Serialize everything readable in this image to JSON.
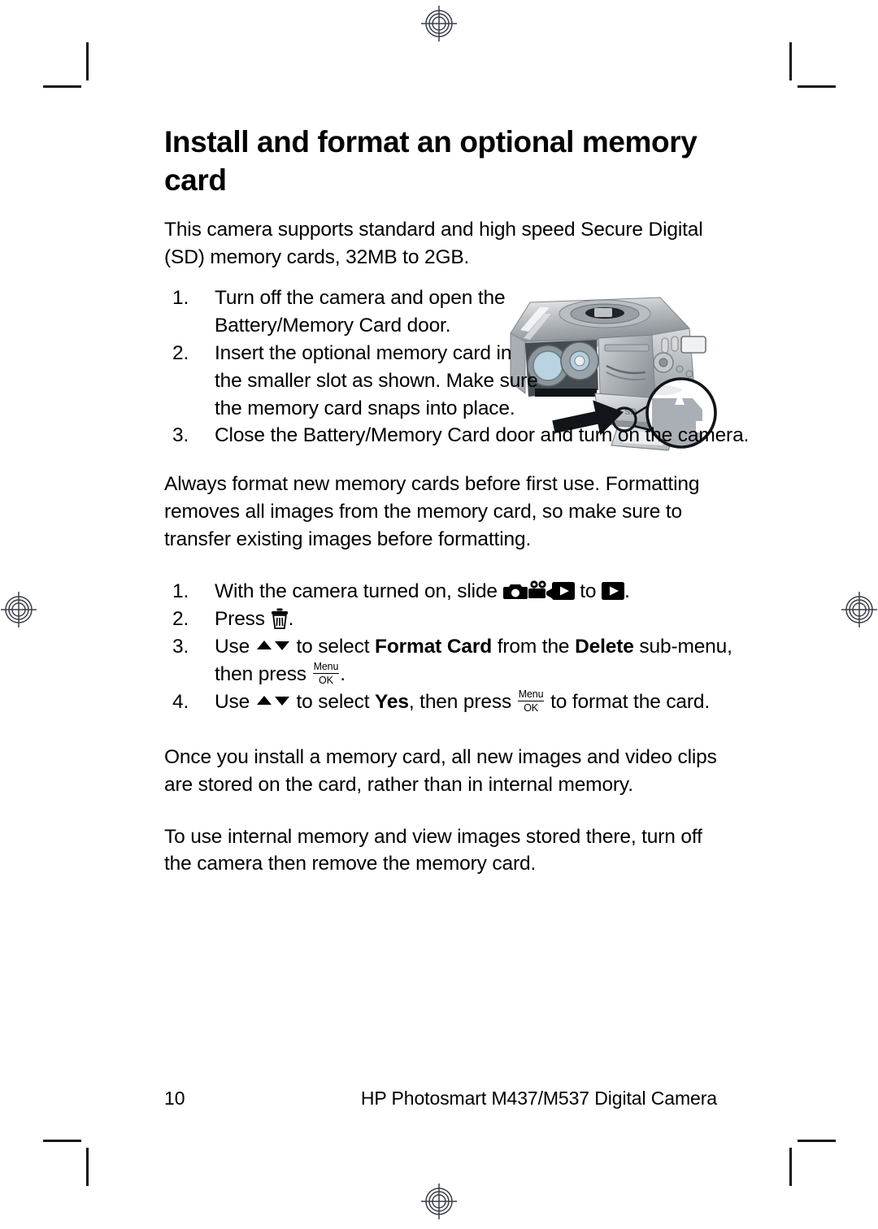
{
  "document": {
    "title": "Install and format an optional memory card",
    "intro": "This camera supports standard and high speed Secure Digital (SD) memory cards, 32MB to 2GB."
  },
  "install_steps": {
    "step1": {
      "num": "1.",
      "text": "Turn off the camera and open the Battery/Memory Card door."
    },
    "step2": {
      "num": "2.",
      "text": "Insert the optional memory card in the smaller slot as shown. Make sure the memory card snaps into place."
    },
    "step3": {
      "num": "3.",
      "text": "Close the Battery/Memory Card door and turn on the camera."
    }
  },
  "figure": {
    "name": "camera-memory-card-insertion-illustration",
    "caption": "Camera with Battery/Memory Card door open showing memory card being inserted into the smaller slot, with magnified detail of card orientation"
  },
  "format_note": "Always format new memory cards before first use. Formatting removes all images from the memory card, so make sure to transfer existing images before formatting.",
  "format_steps": {
    "step1": {
      "num": "1.",
      "pre": "With the camera turned on, slide",
      "mid": "to",
      "post": "."
    },
    "step2": {
      "num": "2.",
      "pre": "Press",
      "post": "."
    },
    "step3": {
      "num": "3.",
      "pre": "Use",
      "mid1": "to select",
      "bold1": "Format Card",
      "mid2": "from the",
      "bold2": "Delete",
      "mid3": "sub-menu, then press",
      "post": "."
    },
    "step4": {
      "num": "4.",
      "pre": "Use",
      "mid1": "to select",
      "bold1": "Yes",
      "mid2": ", then press",
      "post": "to format the card."
    }
  },
  "closing": {
    "para1": "Once you install a memory card, all new images and video clips are stored on the card, rather than in internal memory.",
    "para2": "To use internal memory and view images stored there, turn off the camera then remove the memory card."
  },
  "footer": {
    "page_number": "10",
    "product": "HP Photosmart M437/M537 Digital Camera"
  },
  "icons": {
    "still_capture": "camera-icon",
    "video_capture": "video-camera-icon",
    "playback": "playback-icon",
    "delete": "trash-icon",
    "up_down": "up-down-arrows-icon",
    "menu_ok_top": "Menu",
    "menu_ok_bottom": "OK"
  },
  "print_marks": {
    "registration": "registration-target",
    "crop": "crop-mark"
  },
  "colors": {
    "text": "#000000",
    "page_background": "#ffffff",
    "mark": "#111418"
  }
}
